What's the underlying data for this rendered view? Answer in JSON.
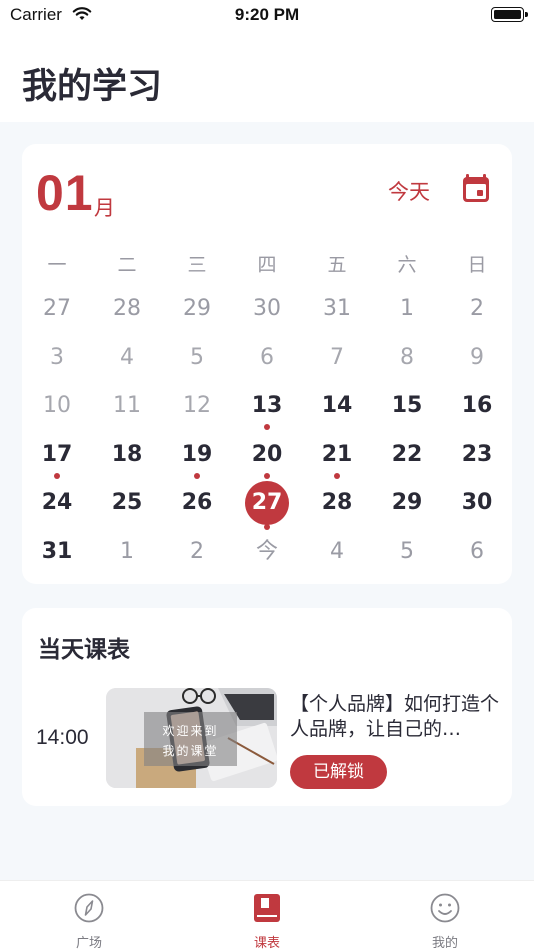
{
  "status_bar": {
    "carrier": "Carrier",
    "time": "9:20 PM"
  },
  "header": {
    "title": "我的学习"
  },
  "calendar": {
    "month": "01",
    "month_unit": "月",
    "today_label": "今天",
    "weekdays": [
      "一",
      "二",
      "三",
      "四",
      "五",
      "六",
      "日"
    ],
    "weeks": [
      [
        {
          "d": "27",
          "s": "other"
        },
        {
          "d": "28",
          "s": "other"
        },
        {
          "d": "29",
          "s": "other"
        },
        {
          "d": "30",
          "s": "other"
        },
        {
          "d": "31",
          "s": "other"
        },
        {
          "d": "1",
          "s": "other"
        },
        {
          "d": "2",
          "s": "other"
        }
      ],
      [
        {
          "d": "3",
          "s": "past"
        },
        {
          "d": "4",
          "s": "past"
        },
        {
          "d": "5",
          "s": "past"
        },
        {
          "d": "6",
          "s": "past"
        },
        {
          "d": "7",
          "s": "past"
        },
        {
          "d": "8",
          "s": "past"
        },
        {
          "d": "9",
          "s": "past"
        }
      ],
      [
        {
          "d": "10",
          "s": "past"
        },
        {
          "d": "11",
          "s": "past"
        },
        {
          "d": "12",
          "s": "past"
        },
        {
          "d": "13",
          "s": "cur",
          "dot": true
        },
        {
          "d": "14",
          "s": "cur"
        },
        {
          "d": "15",
          "s": "cur"
        },
        {
          "d": "16",
          "s": "cur"
        }
      ],
      [
        {
          "d": "17",
          "s": "cur",
          "dot": true
        },
        {
          "d": "18",
          "s": "cur"
        },
        {
          "d": "19",
          "s": "cur",
          "dot": true
        },
        {
          "d": "20",
          "s": "cur",
          "dot": true
        },
        {
          "d": "21",
          "s": "cur",
          "dot": true
        },
        {
          "d": "22",
          "s": "cur"
        },
        {
          "d": "23",
          "s": "cur"
        }
      ],
      [
        {
          "d": "24",
          "s": "cur"
        },
        {
          "d": "25",
          "s": "cur"
        },
        {
          "d": "26",
          "s": "cur"
        },
        {
          "d": "27",
          "s": "selected",
          "dot": true
        },
        {
          "d": "28",
          "s": "cur"
        },
        {
          "d": "29",
          "s": "cur"
        },
        {
          "d": "30",
          "s": "cur"
        }
      ],
      [
        {
          "d": "31",
          "s": "cur"
        },
        {
          "d": "1",
          "s": "other"
        },
        {
          "d": "2",
          "s": "other"
        },
        {
          "d": "今",
          "s": "other"
        },
        {
          "d": "4",
          "s": "other"
        },
        {
          "d": "5",
          "s": "other"
        },
        {
          "d": "6",
          "s": "other"
        }
      ]
    ]
  },
  "schedule": {
    "title": "当天课表",
    "course": {
      "time": "14:00",
      "thumbnail_caption_line1": "欢迎来到",
      "thumbnail_caption_line2": "我的课堂",
      "title": "【个人品牌】如何打造个人品牌，让自己的…",
      "button_label": "已解锁"
    }
  },
  "tabbar": {
    "items": [
      {
        "label": "广场",
        "icon": "compass-icon",
        "active": false
      },
      {
        "label": "课表",
        "icon": "book-icon",
        "active": true
      },
      {
        "label": "我的",
        "icon": "smiley-icon",
        "active": false
      }
    ]
  },
  "colors": {
    "accent": "#c0393f",
    "background": "#f5f8fb",
    "text": "#2a2a36",
    "muted": "#9a9ba4"
  }
}
